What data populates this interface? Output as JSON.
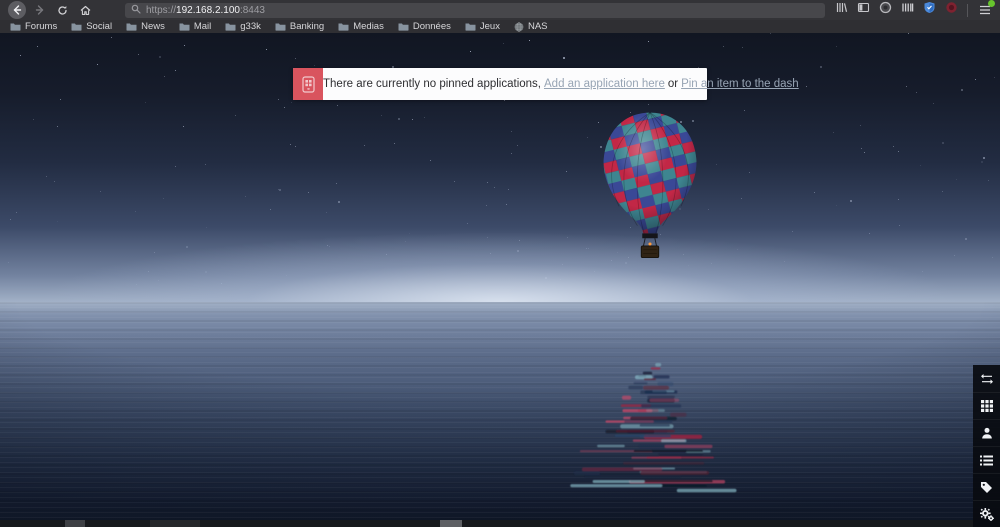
{
  "browser": {
    "nav_icons": [
      "back-icon",
      "forward-icon",
      "reload-icon",
      "home-icon",
      "search-icon"
    ],
    "url": {
      "scheme": "https://",
      "host": "192.168.2.100",
      "port": ":8443"
    },
    "extension_icons": [
      "library-icon",
      "sidebar-icon",
      "extension-circle-icon",
      "extension-bars-icon",
      "extension-shield-icon",
      "extension-red-circle-icon",
      "menu-icon"
    ],
    "bookmarks": [
      {
        "label": "Forums",
        "icon": "folder-icon"
      },
      {
        "label": "Social",
        "icon": "folder-icon"
      },
      {
        "label": "News",
        "icon": "folder-icon"
      },
      {
        "label": "Mail",
        "icon": "folder-icon"
      },
      {
        "label": "g33k",
        "icon": "folder-icon"
      },
      {
        "label": "Banking",
        "icon": "folder-icon"
      },
      {
        "label": "Medias",
        "icon": "folder-icon"
      },
      {
        "label": "Données",
        "icon": "folder-icon"
      },
      {
        "label": "Jeux",
        "icon": "folder-icon"
      },
      {
        "label": "NAS",
        "icon": "globe-icon"
      }
    ]
  },
  "notification": {
    "icon": "no-apps-icon",
    "text": "There are currently no pinned applications,",
    "link_add": "Add an application here",
    "conjunction": "or",
    "link_pin": "Pin an item to the dash"
  },
  "dash_toolbar": {
    "items": [
      {
        "icon": "exchange-arrows-icon"
      },
      {
        "icon": "apps-grid-icon"
      },
      {
        "icon": "user-icon"
      },
      {
        "icon": "item-list-icon"
      },
      {
        "icon": "tag-icon"
      },
      {
        "icon": "settings-cogs-icon"
      }
    ]
  },
  "colors": {
    "notification_accent": "#d9545e",
    "link": "#97a4b4",
    "shield_blue": "#4b89da",
    "menu_badge_green": "#67c42d"
  }
}
